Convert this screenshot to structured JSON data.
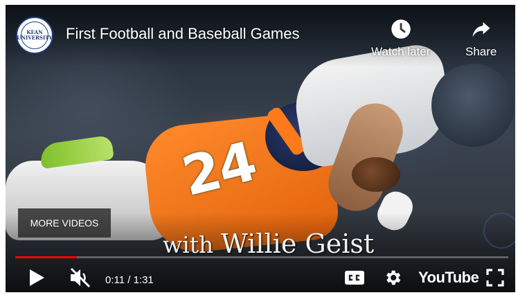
{
  "player": {
    "title": "First Football and Baseball Games",
    "channel_logo": {
      "icon": "university-seal-icon",
      "text": "KEAN UNIVERSITY"
    },
    "top_actions": [
      {
        "label": "Watch later",
        "icon": "clock-icon"
      },
      {
        "label": "Share",
        "icon": "share-arrow-icon"
      }
    ],
    "overlay_caption": {
      "small": "with ",
      "name": "Willie Geist"
    },
    "jersey_number": "24",
    "more_videos_label": "MORE VIDEOS",
    "progress": {
      "played_fraction": 0.125,
      "buffered_fraction": 0.125
    },
    "controls": {
      "play_icon": "play-icon",
      "mute_icon": "muted-speaker-icon",
      "time": "0:11 / 1:31",
      "cc_icon": "closed-captions-icon",
      "settings_icon": "gear-icon",
      "brand": "YouTube",
      "fullscreen_icon": "fullscreen-icon"
    },
    "colors": {
      "progress": "#ff0000",
      "logo_blue": "#1f3b7a"
    }
  }
}
